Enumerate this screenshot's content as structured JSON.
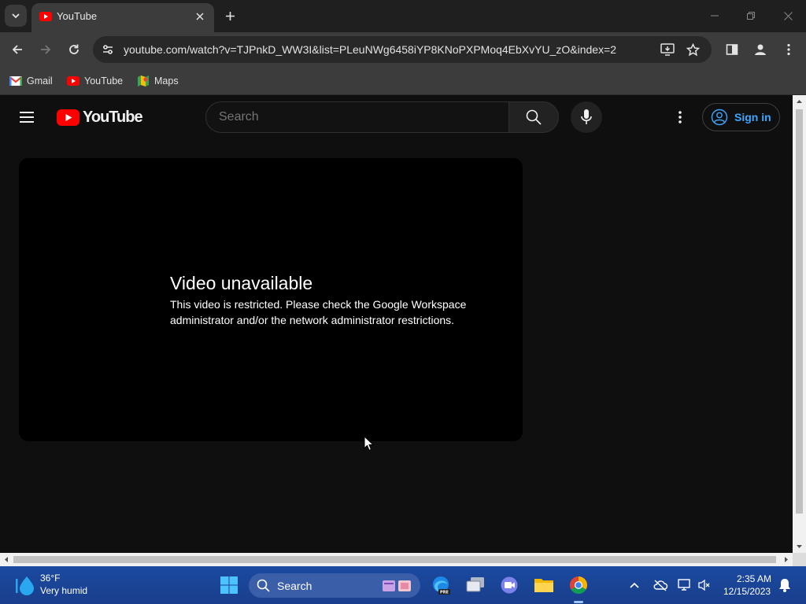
{
  "browser": {
    "tab_title": "YouTube",
    "url": "youtube.com/watch?v=TJPnkD_WW3I&list=PLeuNWg6458iYP8KNoPXPMoq4EbXvYU_zO&index=2",
    "bookmarks": [
      {
        "label": "Gmail",
        "icon": "gmail-icon"
      },
      {
        "label": "YouTube",
        "icon": "youtube-icon"
      },
      {
        "label": "Maps",
        "icon": "maps-icon"
      }
    ]
  },
  "youtube": {
    "logo_text": "YouTube",
    "search_placeholder": "Search",
    "sign_in_label": "Sign in",
    "error_title": "Video unavailable",
    "error_message": "This video is restricted. Please check the Google Workspace administrator and/or the network administrator restrictions."
  },
  "taskbar": {
    "weather_temp": "36°F",
    "weather_desc": "Very humid",
    "search_label": "Search",
    "time": "2:35 AM",
    "date": "12/15/2023"
  },
  "colors": {
    "accent_link": "#3ea6ff",
    "youtube_red": "#ff0000",
    "taskbar": "#1a4aa0"
  }
}
